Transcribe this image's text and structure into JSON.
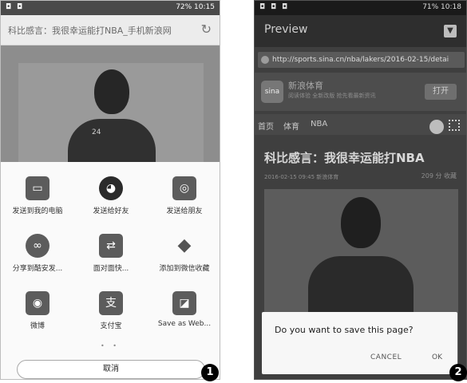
{
  "screen1": {
    "status": {
      "left_icons": "◘ ◘",
      "right": "72% 10:15"
    },
    "title": "科比感言：我很幸运能打NBA_手机新浪网",
    "refresh_icon": "refresh-icon",
    "share_items": [
      {
        "label": "发送到我的电脑",
        "icon": "computer-icon",
        "glyph": "▭"
      },
      {
        "label": "发送给好友",
        "icon": "qq-icon",
        "glyph": "◕"
      },
      {
        "label": "发送给朋友",
        "icon": "wechat-icon",
        "glyph": "◎"
      },
      {
        "label": "分享到酷安发...",
        "icon": "coolapk-icon",
        "glyph": "∞"
      },
      {
        "label": "面对面快...",
        "icon": "face-to-face-icon",
        "glyph": "⇄"
      },
      {
        "label": "添加到微信收藏",
        "icon": "favorite-cube-icon",
        "glyph": "◆"
      },
      {
        "label": "微博",
        "icon": "weibo-icon",
        "glyph": "◉"
      },
      {
        "label": "支付宝",
        "icon": "alipay-icon",
        "glyph": "支"
      },
      {
        "label": "Save as Web...",
        "icon": "save-web-icon",
        "glyph": "◪"
      }
    ],
    "page_dots": "• •",
    "cancel_label": "取消",
    "badge": "1"
  },
  "screen2": {
    "status": {
      "left_icons": "◘ ◘ ◘",
      "right": "71% 10:18"
    },
    "app_title": "Preview",
    "url": "http://sports.sina.cn/nba/lakers/2016-02-15/detai",
    "banner": {
      "logo": "sina",
      "brand": "新浪体育",
      "subtitle": "阅读体验 全新改版 抢先看最新资讯",
      "open_label": "打开"
    },
    "nav": {
      "home": "首页",
      "sports": "体育",
      "nba": "NBA"
    },
    "headline": "科比感言：我很幸运能打NBA",
    "meta_left": "2016-02-15 09:45 新浪体育",
    "meta_right": "209 分 收藏",
    "dialog": {
      "message": "Do you want to save this page?",
      "cancel": "CANCEL",
      "ok": "OK"
    },
    "badge": "2"
  },
  "jersey_number": "24"
}
